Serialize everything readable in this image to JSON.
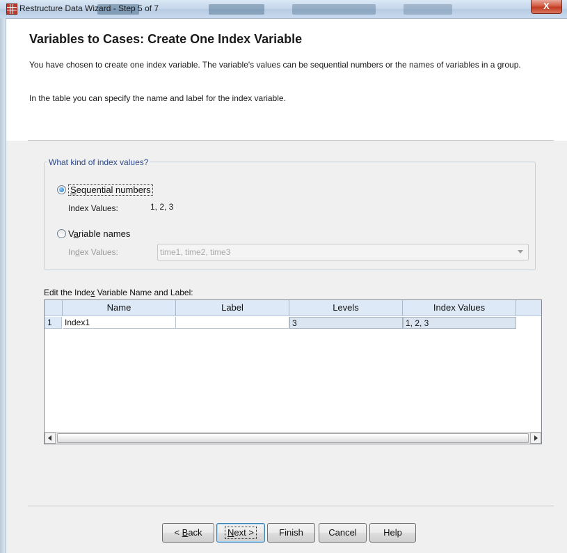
{
  "window": {
    "title": "Restructure Data Wizard - Step 5 of 7",
    "close_label": "X"
  },
  "header": {
    "step_title": "Variables to Cases: Create One Index Variable",
    "description_1": "You have chosen to create one index variable. The variable's values can be sequential numbers or the names of variables in a group.",
    "description_2": "In the table you can specify the name and label for the index variable."
  },
  "index_kind": {
    "legend": "What kind of index values?",
    "sequential": {
      "label": "Sequential numbers",
      "selected": true,
      "index_values_caption": "Index Values:",
      "index_values": "1, 2, 3"
    },
    "variable_names": {
      "label": "Variable names",
      "selected": false,
      "index_values_caption": "Index Values:",
      "index_values": "time1, time2, time3"
    }
  },
  "table": {
    "caption": "Edit the Index Variable Name and Label:",
    "columns": [
      "Name",
      "Label",
      "Levels",
      "Index Values"
    ],
    "rows": [
      {
        "num": "1",
        "name": "Index1",
        "label": "",
        "levels": "3",
        "index_values": "1, 2, 3"
      }
    ]
  },
  "buttons": {
    "back": "< Back",
    "next": "Next >",
    "finish": "Finish",
    "cancel": "Cancel",
    "help": "Help"
  },
  "colors": {
    "group_legend": "#2f4b8a",
    "grid_header": "#dde9f6",
    "default_button_border": "#3c7fb1"
  }
}
